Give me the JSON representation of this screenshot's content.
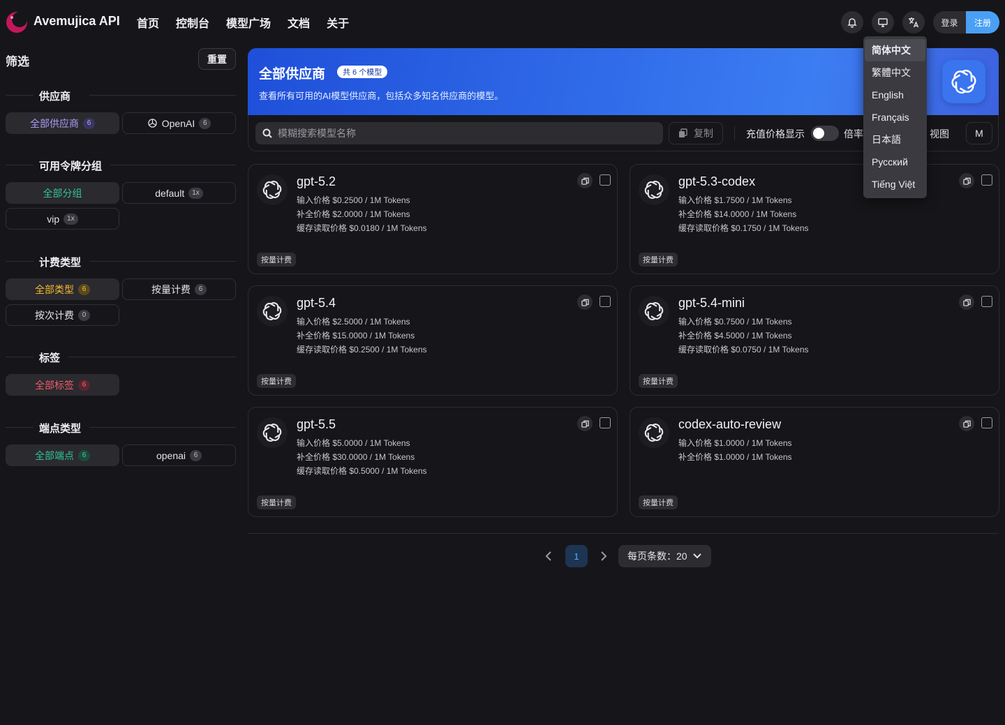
{
  "app": {
    "name": "Avemujica API",
    "logo_color": "#c2185b"
  },
  "nav": [
    "首页",
    "控制台",
    "模型广场",
    "文档",
    "关于"
  ],
  "header_icons": [
    "bell-icon",
    "monitor-icon",
    "translate-icon"
  ],
  "auth": {
    "login": "登录",
    "register": "注册",
    "accent": "#4aa0f5"
  },
  "language_menu": {
    "items": [
      "简体中文",
      "繁體中文",
      "English",
      "Français",
      "日本語",
      "Русский",
      "Tiếng Việt"
    ],
    "selected": "简体中文"
  },
  "sidebar": {
    "title": "筛选",
    "reset": "重置",
    "sections": [
      {
        "title": "供应商",
        "chips": [
          {
            "label": "全部供应商",
            "count": "6",
            "color": "#a99cf5",
            "active": true
          },
          {
            "label": "OpenAI",
            "count": "6",
            "icon": "openai-icon"
          }
        ]
      },
      {
        "title": "可用令牌分组",
        "chips": [
          {
            "label": "全部分组",
            "count": "",
            "color": "#32c496",
            "active": true
          },
          {
            "label": "default",
            "count": "1x"
          },
          {
            "label": "vip",
            "count": "1x"
          }
        ]
      },
      {
        "title": "计费类型",
        "chips": [
          {
            "label": "全部类型",
            "count": "6",
            "color": "#f5b82e",
            "active": true
          },
          {
            "label": "按量计费",
            "count": "6"
          },
          {
            "label": "按次计费",
            "count": "0"
          }
        ]
      },
      {
        "title": "标签",
        "chips": [
          {
            "label": "全部标签",
            "count": "6",
            "color": "#f2596a",
            "active": true
          }
        ]
      },
      {
        "title": "端点类型",
        "chips": [
          {
            "label": "全部端点",
            "count": "6",
            "color": "#32c496",
            "active": true
          },
          {
            "label": "openai",
            "count": "6"
          }
        ]
      }
    ]
  },
  "banner": {
    "title": "全部供应商",
    "badge": "共 6 个模型",
    "desc": "查看所有可用的AI模型供应商，包括众多知名供应商的模型。"
  },
  "toolbar": {
    "search_placeholder": "模糊搜索模型名称",
    "copy": "复制",
    "recharge_price": "充值价格显示",
    "ratio": "倍率",
    "view": "视图",
    "view_btn": "M"
  },
  "cards": [
    {
      "name": "gpt-5.2",
      "prices": [
        "输入价格 $0.2500 / 1M Tokens",
        "补全价格 $2.0000 / 1M Tokens",
        "缓存读取价格 $0.0180 / 1M Tokens"
      ],
      "tag": "按量计费"
    },
    {
      "name": "gpt-5.3-codex",
      "prices": [
        "输入价格 $1.7500 / 1M Tokens",
        "补全价格 $14.0000 / 1M Tokens",
        "缓存读取价格 $0.1750 / 1M Tokens"
      ],
      "tag": "按量计费"
    },
    {
      "name": "gpt-5.4",
      "prices": [
        "输入价格 $2.5000 / 1M Tokens",
        "补全价格 $15.0000 / 1M Tokens",
        "缓存读取价格 $0.2500 / 1M Tokens"
      ],
      "tag": "按量计费"
    },
    {
      "name": "gpt-5.4-mini",
      "prices": [
        "输入价格 $0.7500 / 1M Tokens",
        "补全价格 $4.5000 / 1M Tokens",
        "缓存读取价格 $0.0750 / 1M Tokens"
      ],
      "tag": "按量计费"
    },
    {
      "name": "gpt-5.5",
      "prices": [
        "输入价格 $5.0000 / 1M Tokens",
        "补全价格 $30.0000 / 1M Tokens",
        "缓存读取价格 $0.5000 / 1M Tokens"
      ],
      "tag": "按量计费"
    },
    {
      "name": "codex-auto-review",
      "prices": [
        "输入价格 $1.0000 / 1M Tokens",
        "补全价格 $1.0000 / 1M Tokens"
      ],
      "tag": "按量计费"
    }
  ],
  "pagination": {
    "current": "1",
    "page_size_label": "每页条数：20"
  }
}
